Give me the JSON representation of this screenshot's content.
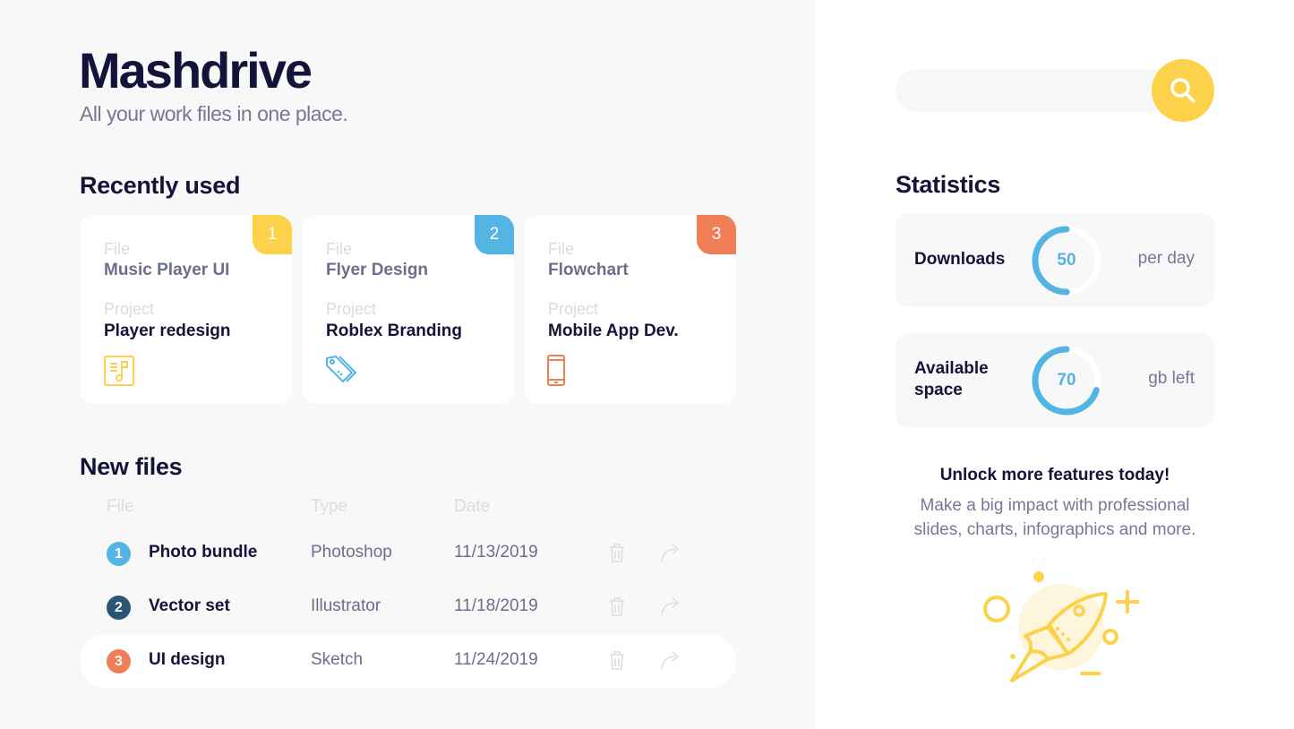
{
  "app": {
    "title": "Mashdrive",
    "subtitle": "All your work files in one place."
  },
  "colors": {
    "yellow": "#fdd24b",
    "blue": "#54b4e4",
    "orange": "#f07e57",
    "dark_teal": "#2b5574",
    "navy": "#14143a"
  },
  "recently_used": {
    "heading": "Recently used",
    "file_label": "File",
    "project_label": "Project",
    "cards": [
      {
        "badge": "1",
        "file": "Music Player UI",
        "project": "Player redesign",
        "icon": "music-document-icon",
        "color": "#fdd24b"
      },
      {
        "badge": "2",
        "file": "Flyer Design",
        "project": "Roblex Branding",
        "icon": "price-tag-icon",
        "color": "#54b4e4"
      },
      {
        "badge": "3",
        "file": "Flowchart",
        "project": "Mobile App Dev.",
        "icon": "smartphone-icon",
        "color": "#f07e57"
      }
    ]
  },
  "new_files": {
    "heading": "New files",
    "columns": [
      "File",
      "Type",
      "Date"
    ],
    "rows": [
      {
        "num": "1",
        "name": "Photo bundle",
        "type": "Photoshop",
        "date": "11/13/2019",
        "color": "#54b4e4",
        "actions": [
          "trash-icon",
          "share-icon"
        ]
      },
      {
        "num": "2",
        "name": "Vector set",
        "type": "Illustrator",
        "date": "11/18/2019",
        "color": "#2b5574",
        "actions": [
          "trash-icon",
          "share-icon"
        ]
      },
      {
        "num": "3",
        "name": "UI design",
        "type": "Sketch",
        "date": "11/24/2019",
        "color": "#f07e57",
        "actions": [
          "trash-icon",
          "share-icon"
        ],
        "highlighted": true
      }
    ]
  },
  "search": {
    "value": "",
    "placeholder": "",
    "button_icon": "search-icon"
  },
  "statistics": {
    "heading": "Statistics",
    "items": [
      {
        "label": "Downloads",
        "value": "50",
        "unit": "per day",
        "progress_percent": 50
      },
      {
        "label": "Available space",
        "value": "70",
        "unit": "gb left",
        "progress_percent": 70
      }
    ]
  },
  "promo": {
    "title": "Unlock more features today!",
    "text": "Make a big impact with professional slides, charts, infographics and more.",
    "illustration": "rocket-icon"
  }
}
